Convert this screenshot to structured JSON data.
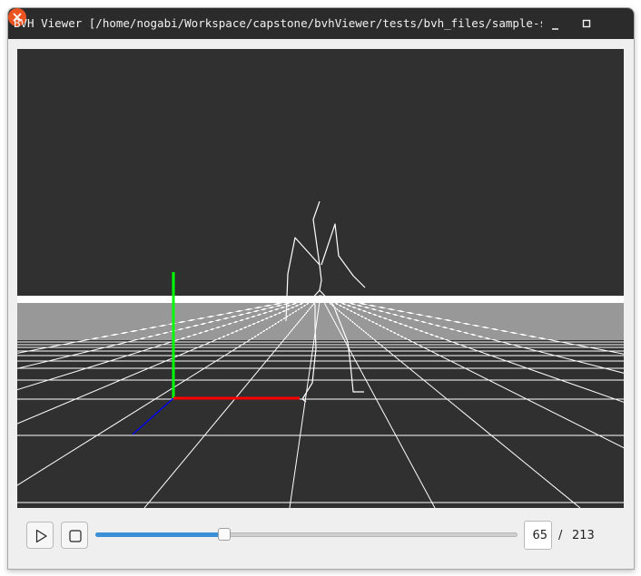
{
  "window": {
    "title": "BVH Viewer [/home/nogabi/Workspace/capstone/bvhViewer/tests/bvh_files/sample-spin...",
    "minimize_icon": "minimize-icon",
    "maximize_icon": "maximize-icon",
    "close_icon": "close-icon",
    "close_color": "#e95420"
  },
  "viewport": {
    "background_color": "#303030",
    "grid_color": "#ffffff",
    "axis_colors": {
      "x": "#ff0000",
      "y": "#00ff00",
      "z": "#0000ff"
    }
  },
  "controls": {
    "play_icon": "play-icon",
    "stop_icon": "stop-icon",
    "current_frame": "65",
    "separator": "/",
    "total_frames": "213",
    "slider_progress": 0.305
  },
  "colors": {
    "accent": "#3a8fd6"
  }
}
